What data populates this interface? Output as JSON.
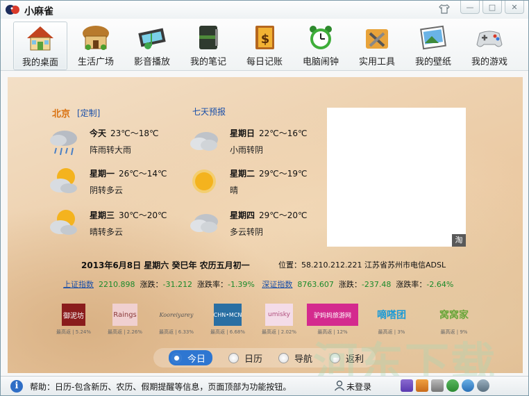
{
  "app": {
    "title": "小麻雀"
  },
  "toolbar": {
    "items": [
      {
        "label": "我的桌面",
        "icon": "house-icon"
      },
      {
        "label": "生活广场",
        "icon": "market-hut-icon"
      },
      {
        "label": "影音播放",
        "icon": "film-music-icon"
      },
      {
        "label": "我的笔记",
        "icon": "notebook-icon"
      },
      {
        "label": "每日记账",
        "icon": "ledger-dollar-icon"
      },
      {
        "label": "电脑闹钟",
        "icon": "alarm-clock-icon"
      },
      {
        "label": "实用工具",
        "icon": "tools-icon"
      },
      {
        "label": "我的壁纸",
        "icon": "wallpaper-icon"
      },
      {
        "label": "我的游戏",
        "icon": "gamepad-icon"
      }
    ],
    "active_index": 0
  },
  "weather": {
    "city": "北京",
    "customize": "[定制]",
    "forecast_link": "七天预报",
    "days": [
      {
        "day": "今天",
        "temp": "23℃～18℃",
        "cond": "阵雨转大雨",
        "icon": "rain-cloud-icon"
      },
      {
        "day": "星期日",
        "temp": "22℃～16℃",
        "cond": "小雨转阴",
        "icon": "cloud-icon"
      },
      {
        "day": "星期一",
        "temp": "26℃～14℃",
        "cond": "阴转多云",
        "icon": "sun-cloud-icon"
      },
      {
        "day": "星期二",
        "temp": "29℃～19℃",
        "cond": "晴",
        "icon": "sun-icon"
      },
      {
        "day": "星期三",
        "temp": "30℃～20℃",
        "cond": "晴转多云",
        "icon": "sun-cloud-icon"
      },
      {
        "day": "星期四",
        "temp": "29℃～20℃",
        "cond": "多云转阴",
        "icon": "cloud-icon"
      }
    ]
  },
  "ad": {
    "badge": "淘"
  },
  "date": {
    "line": "2013年6月8日  星期六  癸巳年  农历五月初一",
    "location": "位置：58.210.212.221  江苏省苏州市电信ADSL"
  },
  "stocks": {
    "sh_name": "上证指数",
    "sh_value": "2210.898",
    "change_label": "涨跌：",
    "sh_change": "-31.212",
    "rate_label": "涨跌率：",
    "sh_rate": "-1.39%",
    "sz_name": "深证指数",
    "sz_value": "8763.607",
    "sz_change": "-237.48",
    "sz_rate": "-2.64%"
  },
  "brands": [
    {
      "name": "御泥坊",
      "cap": "最高返 | 5.24%",
      "color": "#8a1c1c"
    },
    {
      "name": "Raings",
      "cap": "最高返 | 2.26%",
      "color": "#c98a8a"
    },
    {
      "name": "Kooreiyarey",
      "cap": "最高返 | 6.33%",
      "color": "#777777"
    },
    {
      "name": "CHN•MCN",
      "cap": "最高返 | 6.68%",
      "color": "#2a6fa3"
    },
    {
      "name": "umisky",
      "cap": "最高返 | 2.02%",
      "color": "#c97aa8"
    },
    {
      "name": "驴妈妈旅游网",
      "cap": "最高返 | 12%",
      "color": "#d42a8e"
    },
    {
      "name": "嘀嗒团",
      "cap": "最高返 | 3%",
      "color": "#1b9ad6"
    },
    {
      "name": "窝窝家",
      "cap": "最高返 | 9%",
      "color": "#6aa63a"
    }
  ],
  "tabs": [
    {
      "label": "今日"
    },
    {
      "label": "日历"
    },
    {
      "label": "导航"
    },
    {
      "label": "返利"
    }
  ],
  "status": {
    "help": "帮助：日历-包含新历、农历、假期提醒等信息，页面顶部为功能按钮。",
    "login": "未登录"
  },
  "watermark": "河东下载",
  "colors": {
    "accent": "#2e76d1",
    "city": "#d9700e",
    "link": "#1a4fa8",
    "stock_green": "#1a8a2a"
  }
}
